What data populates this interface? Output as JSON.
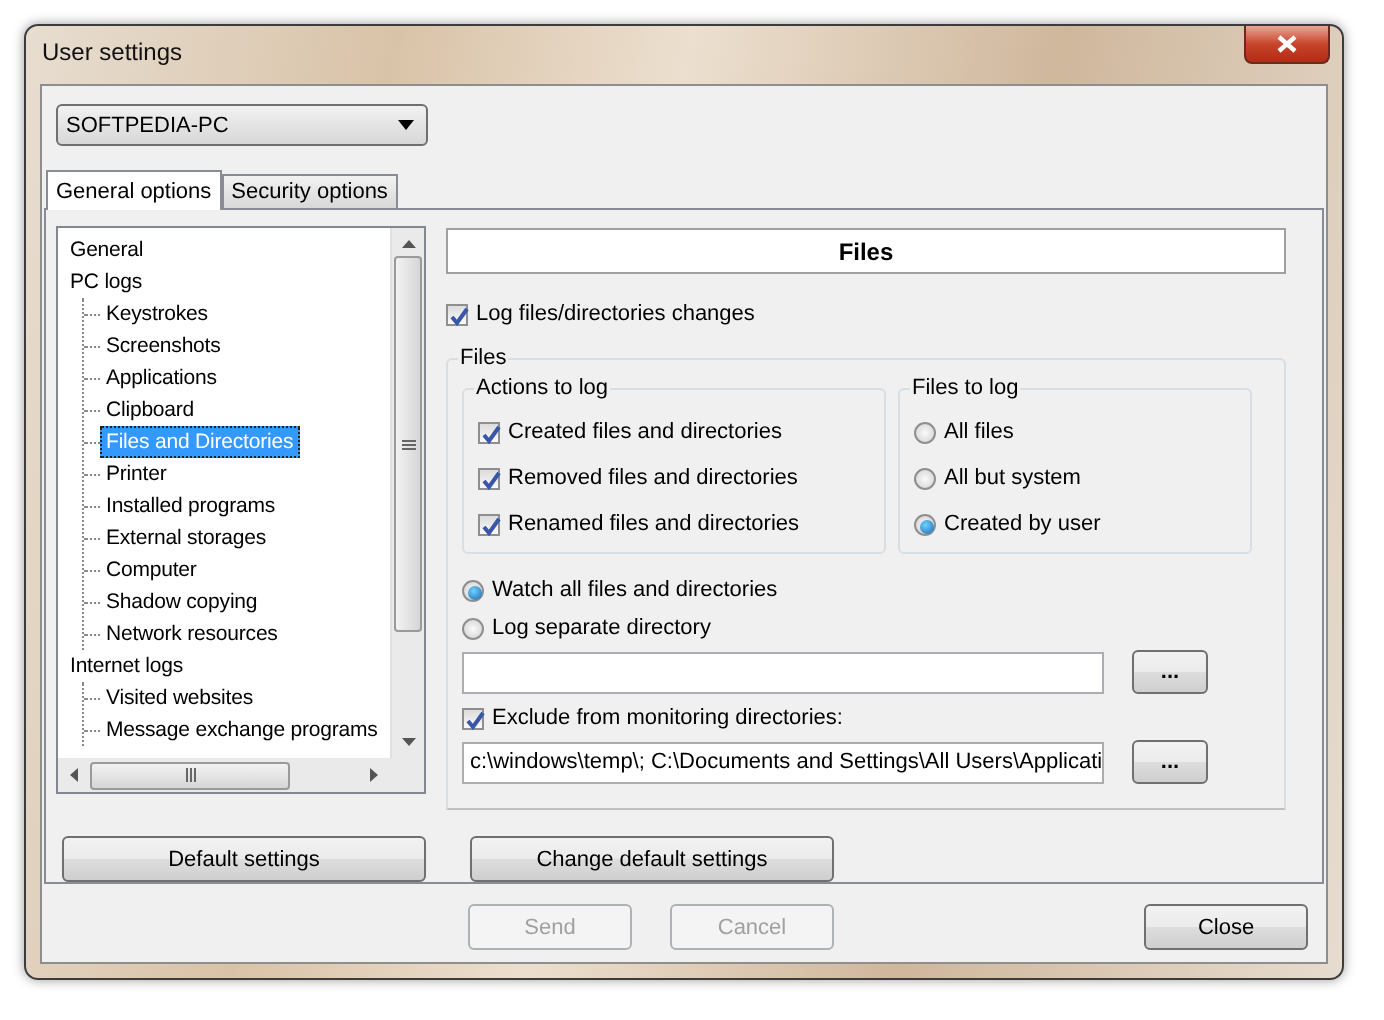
{
  "window": {
    "title": "User settings"
  },
  "computer": {
    "value": "SOFTPEDIA-PC"
  },
  "tabs": [
    {
      "label": "General options",
      "selected": true
    },
    {
      "label": "Security options",
      "selected": false
    }
  ],
  "tree": {
    "items": [
      {
        "label": "General",
        "selected": false
      },
      {
        "label": "PC logs",
        "selected": false,
        "children": [
          {
            "label": "Keystrokes",
            "selected": false
          },
          {
            "label": "Screenshots",
            "selected": false
          },
          {
            "label": "Applications",
            "selected": false
          },
          {
            "label": "Clipboard",
            "selected": false
          },
          {
            "label": "Files and Directories",
            "selected": true
          },
          {
            "label": "Printer",
            "selected": false
          },
          {
            "label": "Installed programs",
            "selected": false
          },
          {
            "label": "External storages",
            "selected": false
          },
          {
            "label": "Computer",
            "selected": false
          },
          {
            "label": "Shadow copying",
            "selected": false
          },
          {
            "label": "Network resources",
            "selected": false
          }
        ]
      },
      {
        "label": "Internet logs",
        "selected": false,
        "children": [
          {
            "label": "Visited websites",
            "selected": false
          },
          {
            "label": "Message exchange programs",
            "selected": false
          }
        ]
      }
    ]
  },
  "panel": {
    "title": "Files",
    "log_changes": {
      "label": "Log files/directories changes",
      "checked": true
    },
    "group_title": "Files",
    "actions": {
      "title": "Actions to log",
      "items": [
        {
          "label": "Created files and directories",
          "checked": true
        },
        {
          "label": "Removed files and directories",
          "checked": true
        },
        {
          "label": "Renamed files and directories",
          "checked": true
        }
      ]
    },
    "files_to_log": {
      "title": "Files to log",
      "options": [
        {
          "label": "All files",
          "selected": false
        },
        {
          "label": "All but system",
          "selected": false
        },
        {
          "label": "Created by user",
          "selected": true
        }
      ]
    },
    "watch_mode": [
      {
        "label": "Watch all files and directories",
        "selected": true
      },
      {
        "label": "Log separate directory",
        "selected": false
      }
    ],
    "directory_browse": "...",
    "exclude": {
      "label": "Exclude from monitoring directories:",
      "checked": true
    },
    "exclude_dirs": {
      "value": "c:\\windows\\temp\\; C:\\Documents and Settings\\All Users\\Applicati"
    },
    "exclude_browse": "..."
  },
  "default_settings_button": "Default settings",
  "change_default_button": "Change default settings",
  "footer_buttons": [
    {
      "label": "Send",
      "disabled": true
    },
    {
      "label": "Cancel",
      "disabled": true
    },
    {
      "label": "Close",
      "disabled": false
    }
  ]
}
